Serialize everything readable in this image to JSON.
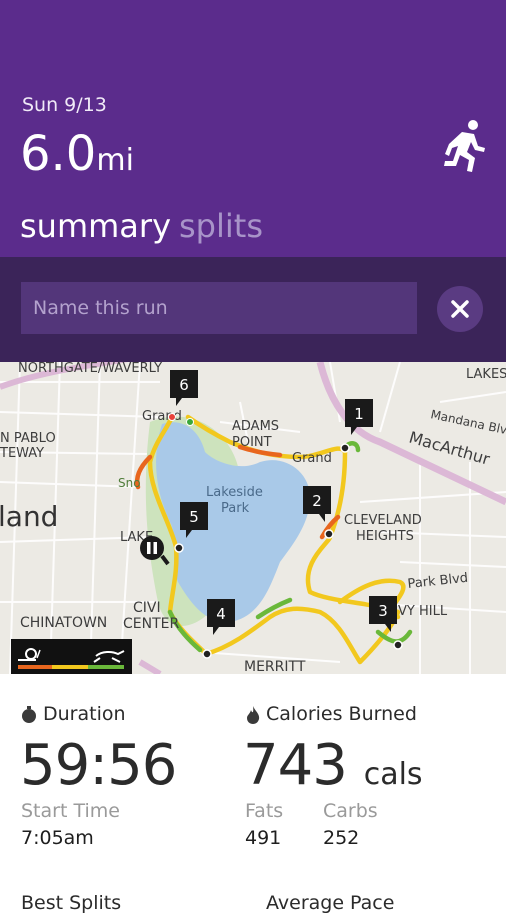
{
  "header": {
    "date": "Sun 9/13",
    "distance_value": "6.0",
    "distance_unit": "mi",
    "activity_icon": "running-person-icon",
    "tabs": [
      "summary",
      "splits"
    ],
    "active_tab": "summary"
  },
  "name_field": {
    "placeholder": "Name this run",
    "value": "",
    "clear_icon": "close-icon"
  },
  "map": {
    "labels": [
      "NORTHGATE/WAVERLY",
      "LAKES",
      "Mandana Blv",
      "ADAMS",
      "POINT",
      "Grand",
      "Grand",
      "MacArthur",
      "N PABLO",
      "TEWAY",
      "land",
      "Lakeside",
      "Park",
      "CLEVELAND",
      "HEIGHTS",
      "Park Blvd",
      "VY HILL",
      "CHINATOWN",
      "CIVI",
      "CENTER",
      "MERRITT",
      "Sno",
      "LAKE"
    ],
    "split_markers": [
      "1",
      "2",
      "3",
      "4",
      "5",
      "6"
    ],
    "pace_legend": {
      "slow_icon": "snail-icon",
      "fast_icon": "cheetah-icon"
    },
    "pause_icon": "pause-icon",
    "colors": {
      "route_medium": "#f2c81e",
      "route_fast": "#6ab83a",
      "route_slow": "#e8661e",
      "lake": "#a9c9e8",
      "park": "#cde3bd"
    }
  },
  "stats": {
    "duration": {
      "label": "Duration",
      "value": "59:56",
      "icon": "stopwatch-icon"
    },
    "start_time": {
      "label": "Start Time",
      "value": "7:05am"
    },
    "calories": {
      "label": "Calories Burned",
      "value": "743",
      "unit": "cals",
      "icon": "flame-icon"
    },
    "fats": {
      "label": "Fats",
      "value": "491"
    },
    "carbs": {
      "label": "Carbs",
      "value": "252"
    },
    "next_left": "Best Splits",
    "next_right": "Average Pace"
  },
  "theme": {
    "primary": "#5b2c8c",
    "primary_dark": "#3b2459"
  }
}
